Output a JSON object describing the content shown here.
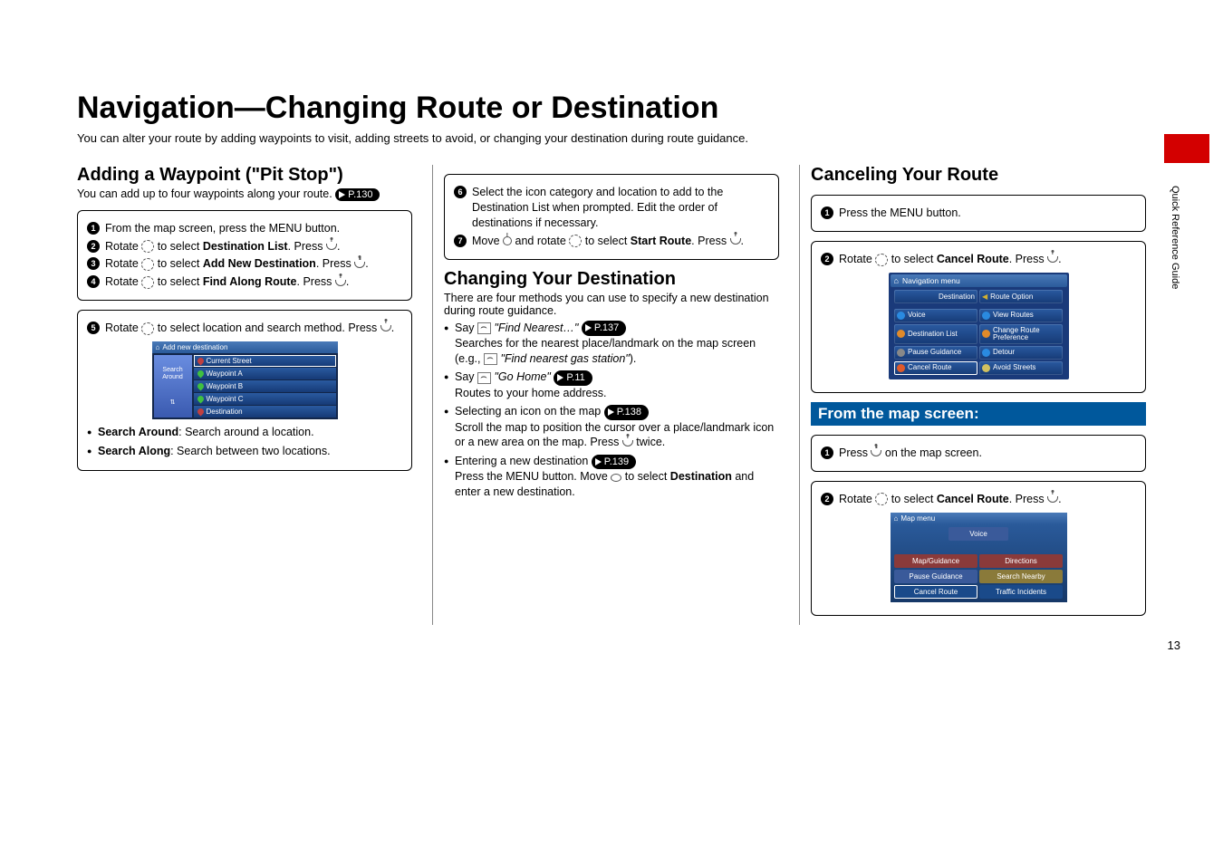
{
  "side_label": "Quick Reference Guide",
  "page_number": "13",
  "title": "Navigation—Changing Route or Destination",
  "intro": "You can alter your route by adding waypoints to visit, adding streets to avoid, or changing your destination during route guidance.",
  "col1": {
    "h2": "Adding a Waypoint (\"Pit Stop\")",
    "sub": "You can add up to four waypoints along your route. ",
    "pref": "P.130",
    "steps1": {
      "s1": "From the map screen, press the MENU button.",
      "s2a": "Rotate ",
      "s2b": " to select ",
      "s2c": "Destination List",
      "s2d": ". Press ",
      "s2e": ".",
      "s3a": "Rotate ",
      "s3b": " to select ",
      "s3c": "Add New Destination",
      "s3d": ". Press ",
      "s3e": ".",
      "s4a": "Rotate ",
      "s4b": " to select ",
      "s4c": "Find Along Route",
      "s4d": ". Press ",
      "s4e": "."
    },
    "step5a": "Rotate ",
    "step5b": " to select location and search method. Press ",
    "step5c": ".",
    "bullets": {
      "b1a": "Search Around",
      "b1b": ": Search around a location.",
      "b2a": "Search Along",
      "b2b": ": Search between two locations."
    },
    "ss": {
      "hdr": "Add new destination",
      "side_top": "Search Around",
      "side_bot": "⇅",
      "rows": [
        "Current Street",
        "Waypoint A",
        "Waypoint B",
        "Waypoint C",
        "Destination"
      ]
    }
  },
  "col2": {
    "step6": "Select the icon category and location to add to the Destination List when prompted. Edit the order of destinations if necessary.",
    "step7a": "Move ",
    "step7b": " and rotate ",
    "step7c": " to select ",
    "step7d": "Start Route",
    "step7e": ". Press ",
    "step7f": ".",
    "h2": "Changing Your Destination",
    "sub": "There are four methods you can use to specify a new destination during route guidance.",
    "b1a": "Say ",
    "b1b": "\"Find Nearest…\"",
    "b1pref": "P.137",
    "b1c": "Searches for the nearest place/landmark on the map screen (e.g., ",
    "b1d": "\"Find nearest gas station\"",
    "b1e": ").",
    "b2a": "Say ",
    "b2b": "\"Go Home\"",
    "b2pref": "P.11",
    "b2c": "Routes to your home address.",
    "b3a": "Selecting an icon on the map ",
    "b3pref": "P.138",
    "b3b": "Scroll the map to position the cursor over a place/landmark icon or a new area on the map. Press ",
    "b3c": " twice.",
    "b4a": "Entering a new destination ",
    "b4pref": "P.139",
    "b4b": "Press the MENU button. Move ",
    "b4c": " to select ",
    "b4d": "Destination",
    "b4e": " and enter a new destination."
  },
  "col3": {
    "h2": "Canceling Your Route",
    "s1": "Press the MENU button.",
    "s2a": "Rotate ",
    "s2b": " to select ",
    "s2c": "Cancel Route",
    "s2d": ". Press ",
    "s2e": ".",
    "h3": "From the map screen:",
    "m1a": "Press ",
    "m1b": " on the map screen.",
    "m2a": "Rotate ",
    "m2b": " to select ",
    "m2c": "Cancel Route",
    "m2d": ". Press ",
    "m2e": ".",
    "nav_ss": {
      "hdr": "Navigation menu",
      "top_l": "Destination",
      "top_r": "Route Option",
      "items": [
        {
          "t": "Voice",
          "c": "#2a8ae0"
        },
        {
          "t": "View Routes",
          "c": "#2a8ae0"
        },
        {
          "t": "Destination List",
          "c": "#e08a2a"
        },
        {
          "t": "Change Route Preference",
          "c": "#e08a2a"
        },
        {
          "t": "Pause Guidance",
          "c": "#888"
        },
        {
          "t": "Detour",
          "c": "#2a8ae0"
        },
        {
          "t": "Cancel Route",
          "c": "#e05a2a",
          "sel": true
        },
        {
          "t": "Avoid Streets",
          "c": "#d0c060"
        }
      ]
    },
    "map_ss": {
      "hdr": "Map menu",
      "voice": "Voice",
      "btns": [
        {
          "t": "Map/Guidance",
          "bg": "#8a3a3a"
        },
        {
          "t": "Directions",
          "bg": "#8a3a3a"
        },
        {
          "t": "Pause Guidance",
          "bg": "#3a5a9a"
        },
        {
          "t": "Search Nearby",
          "bg": "#8a7a3a"
        },
        {
          "t": "Cancel Route",
          "bg": "#1a4a8a",
          "sel": true
        },
        {
          "t": "Traffic Incidents",
          "bg": "#1a4a8a"
        }
      ]
    }
  }
}
